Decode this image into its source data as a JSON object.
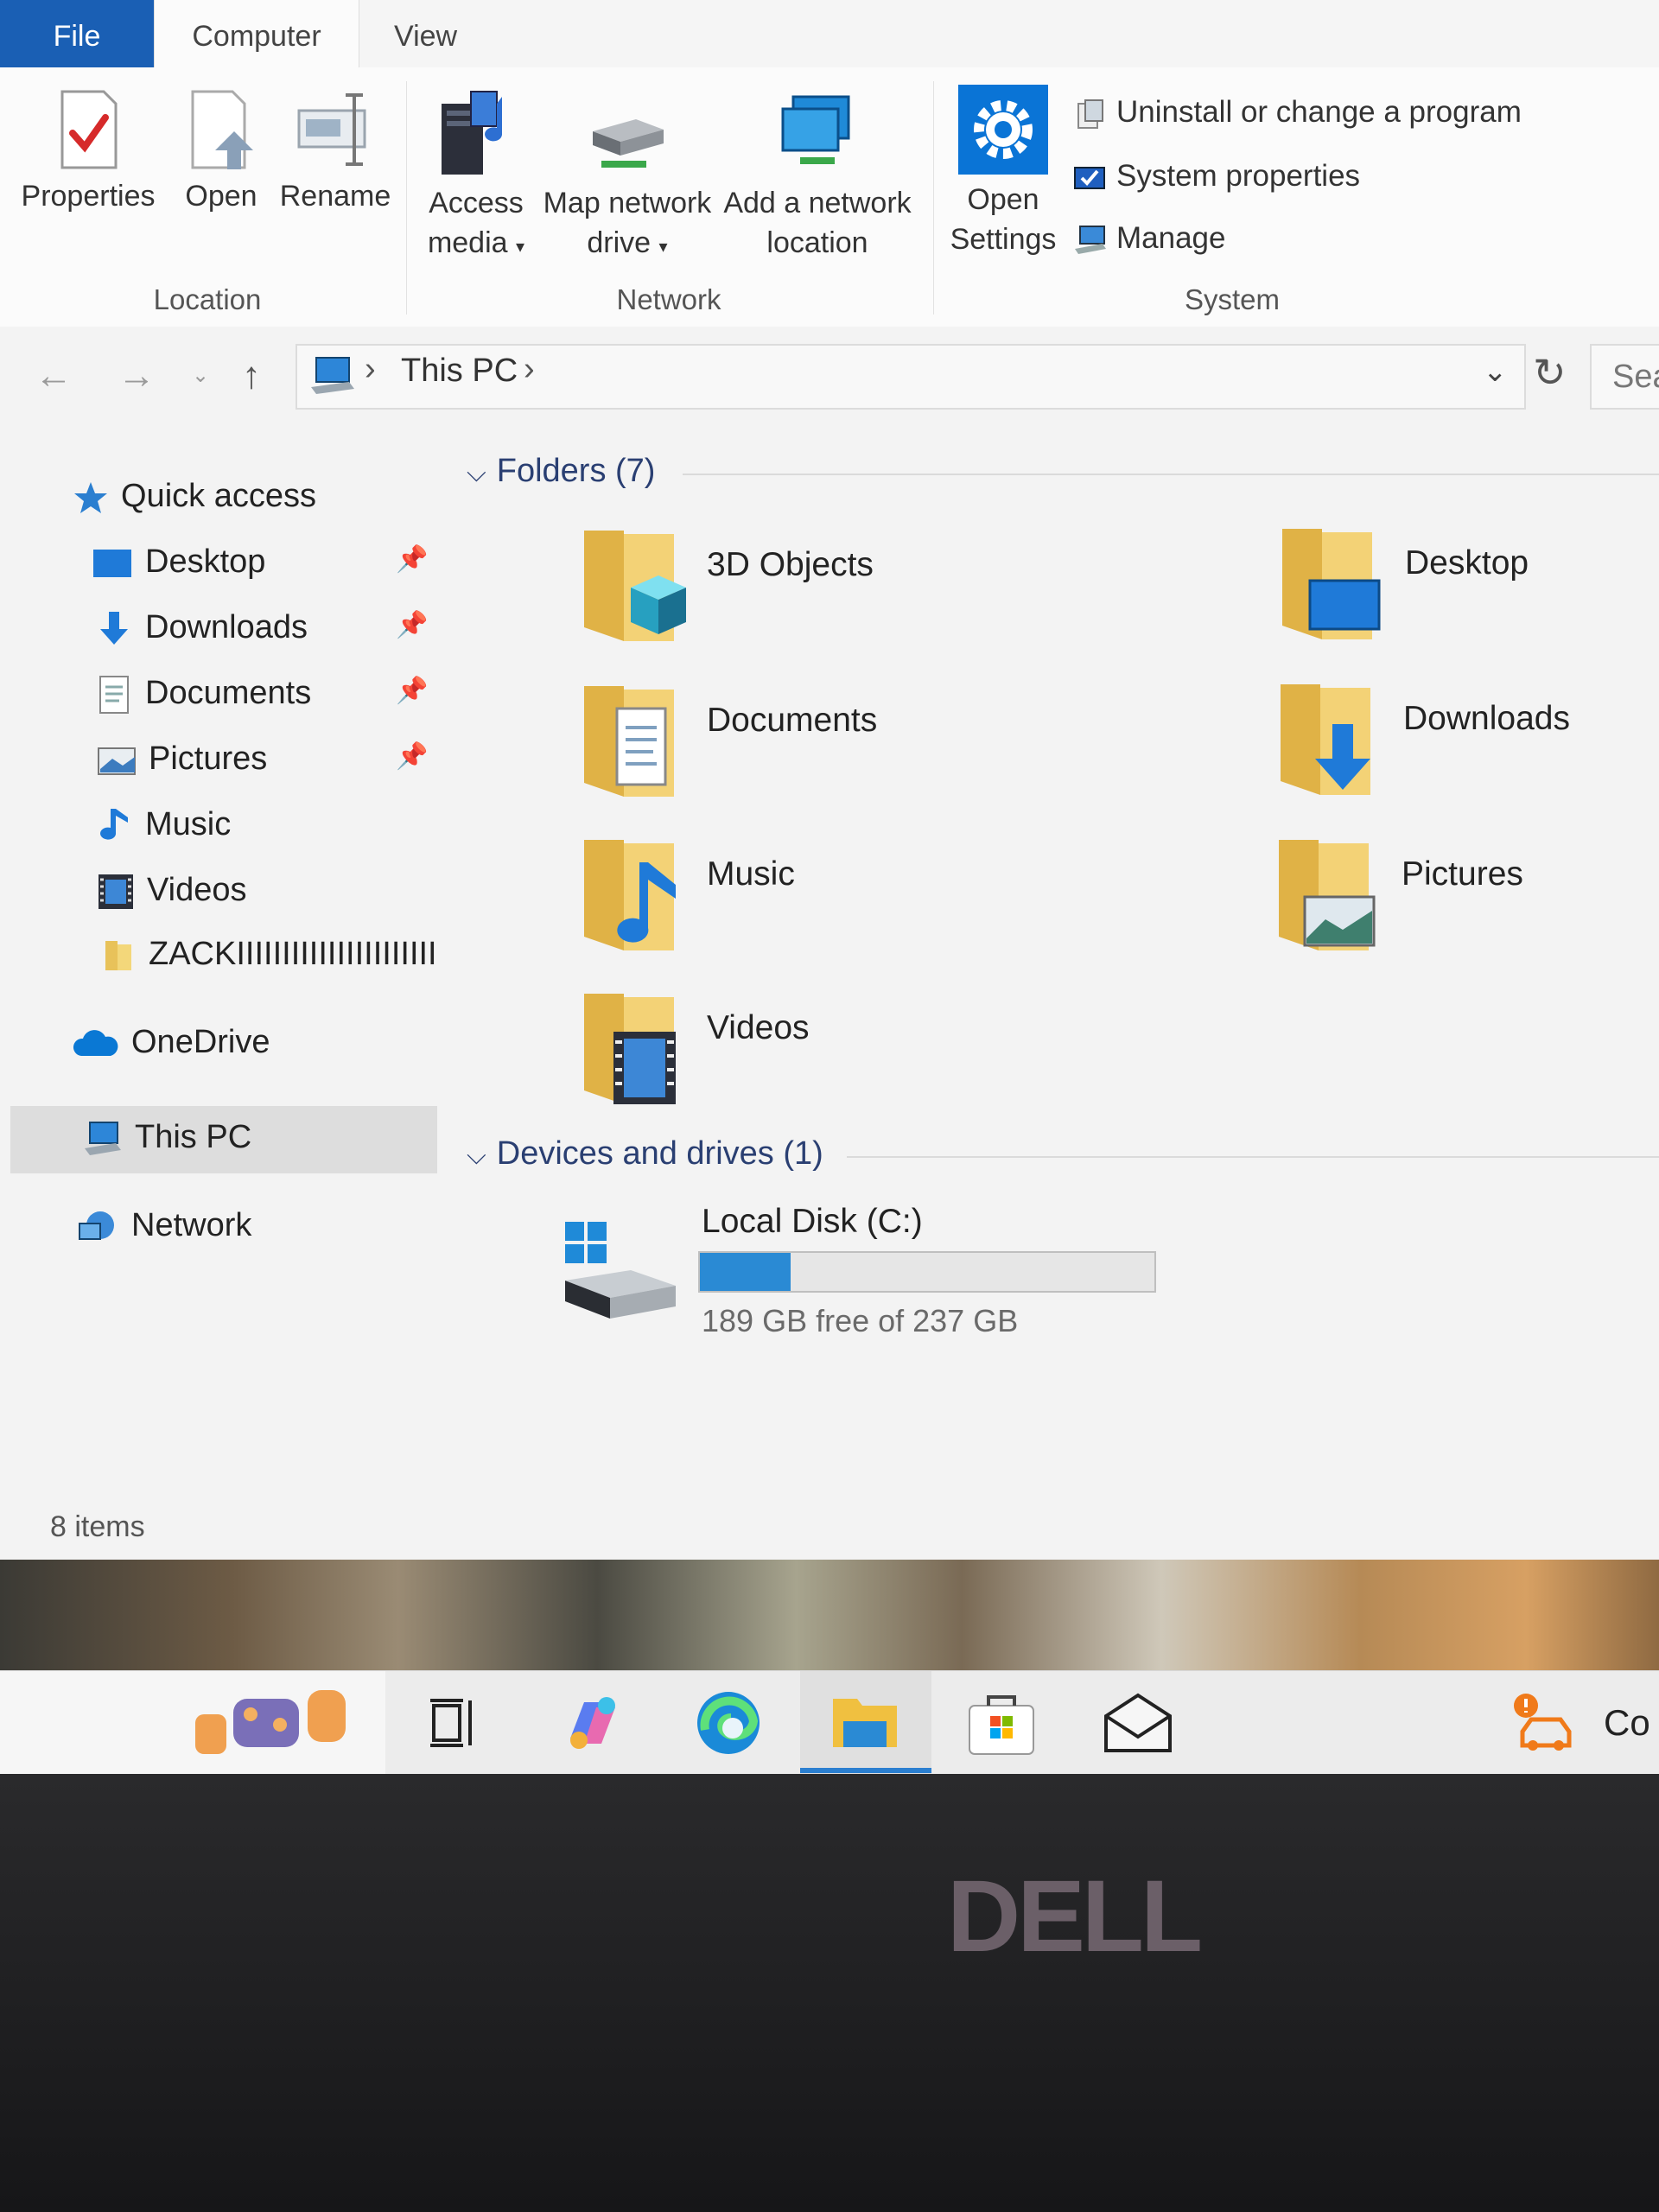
{
  "ribbon": {
    "tabs": [
      "File",
      "Computer",
      "View"
    ],
    "location": {
      "label": "Location",
      "properties": "Properties",
      "open": "Open",
      "rename": "Rename"
    },
    "network": {
      "label": "Network",
      "access_media": [
        "Access",
        "media"
      ],
      "map_network_drive": [
        "Map network",
        "drive"
      ],
      "add_network_location": [
        "Add a network",
        "location"
      ]
    },
    "system": {
      "label": "System",
      "open_settings": [
        "Open",
        "Settings"
      ],
      "uninstall": "Uninstall or change a program",
      "system_properties": "System properties",
      "manage": "Manage"
    }
  },
  "address": {
    "crumb": "This PC",
    "search_placeholder": "Sea"
  },
  "sidebar": {
    "quick_access": "Quick access",
    "items": [
      {
        "label": "Desktop",
        "pinned": true
      },
      {
        "label": "Downloads",
        "pinned": true
      },
      {
        "label": "Documents",
        "pinned": true
      },
      {
        "label": "Pictures",
        "pinned": true
      },
      {
        "label": "Music",
        "pinned": false
      },
      {
        "label": "Videos",
        "pinned": false
      },
      {
        "label": "ZACKIIIIIIIIIIIIIIIIIIIIII",
        "pinned": false
      }
    ],
    "onedrive": "OneDrive",
    "this_pc": "This PC",
    "network": "Network"
  },
  "content": {
    "folders_header": "Folders (7)",
    "folders": [
      "3D Objects",
      "Desktop",
      "Documents",
      "Downloads",
      "Music",
      "Pictures",
      "Videos"
    ],
    "devices_header": "Devices and drives (1)",
    "drive": {
      "name": "Local Disk (C:)",
      "free_text": "189 GB free of 237 GB",
      "used_fraction": 0.2
    }
  },
  "status": {
    "items": "8 items"
  },
  "taskbar": {
    "apps": [
      "widgets",
      "task-view",
      "copilot",
      "edge",
      "file-explorer",
      "store",
      "mail",
      "alert"
    ],
    "truncated_text": "Co"
  },
  "bezel": {
    "logo": "DELL"
  },
  "colors": {
    "accent": "#1a5fb4",
    "folder": "#e8c25a",
    "drive_fill": "#2a8ad4"
  }
}
